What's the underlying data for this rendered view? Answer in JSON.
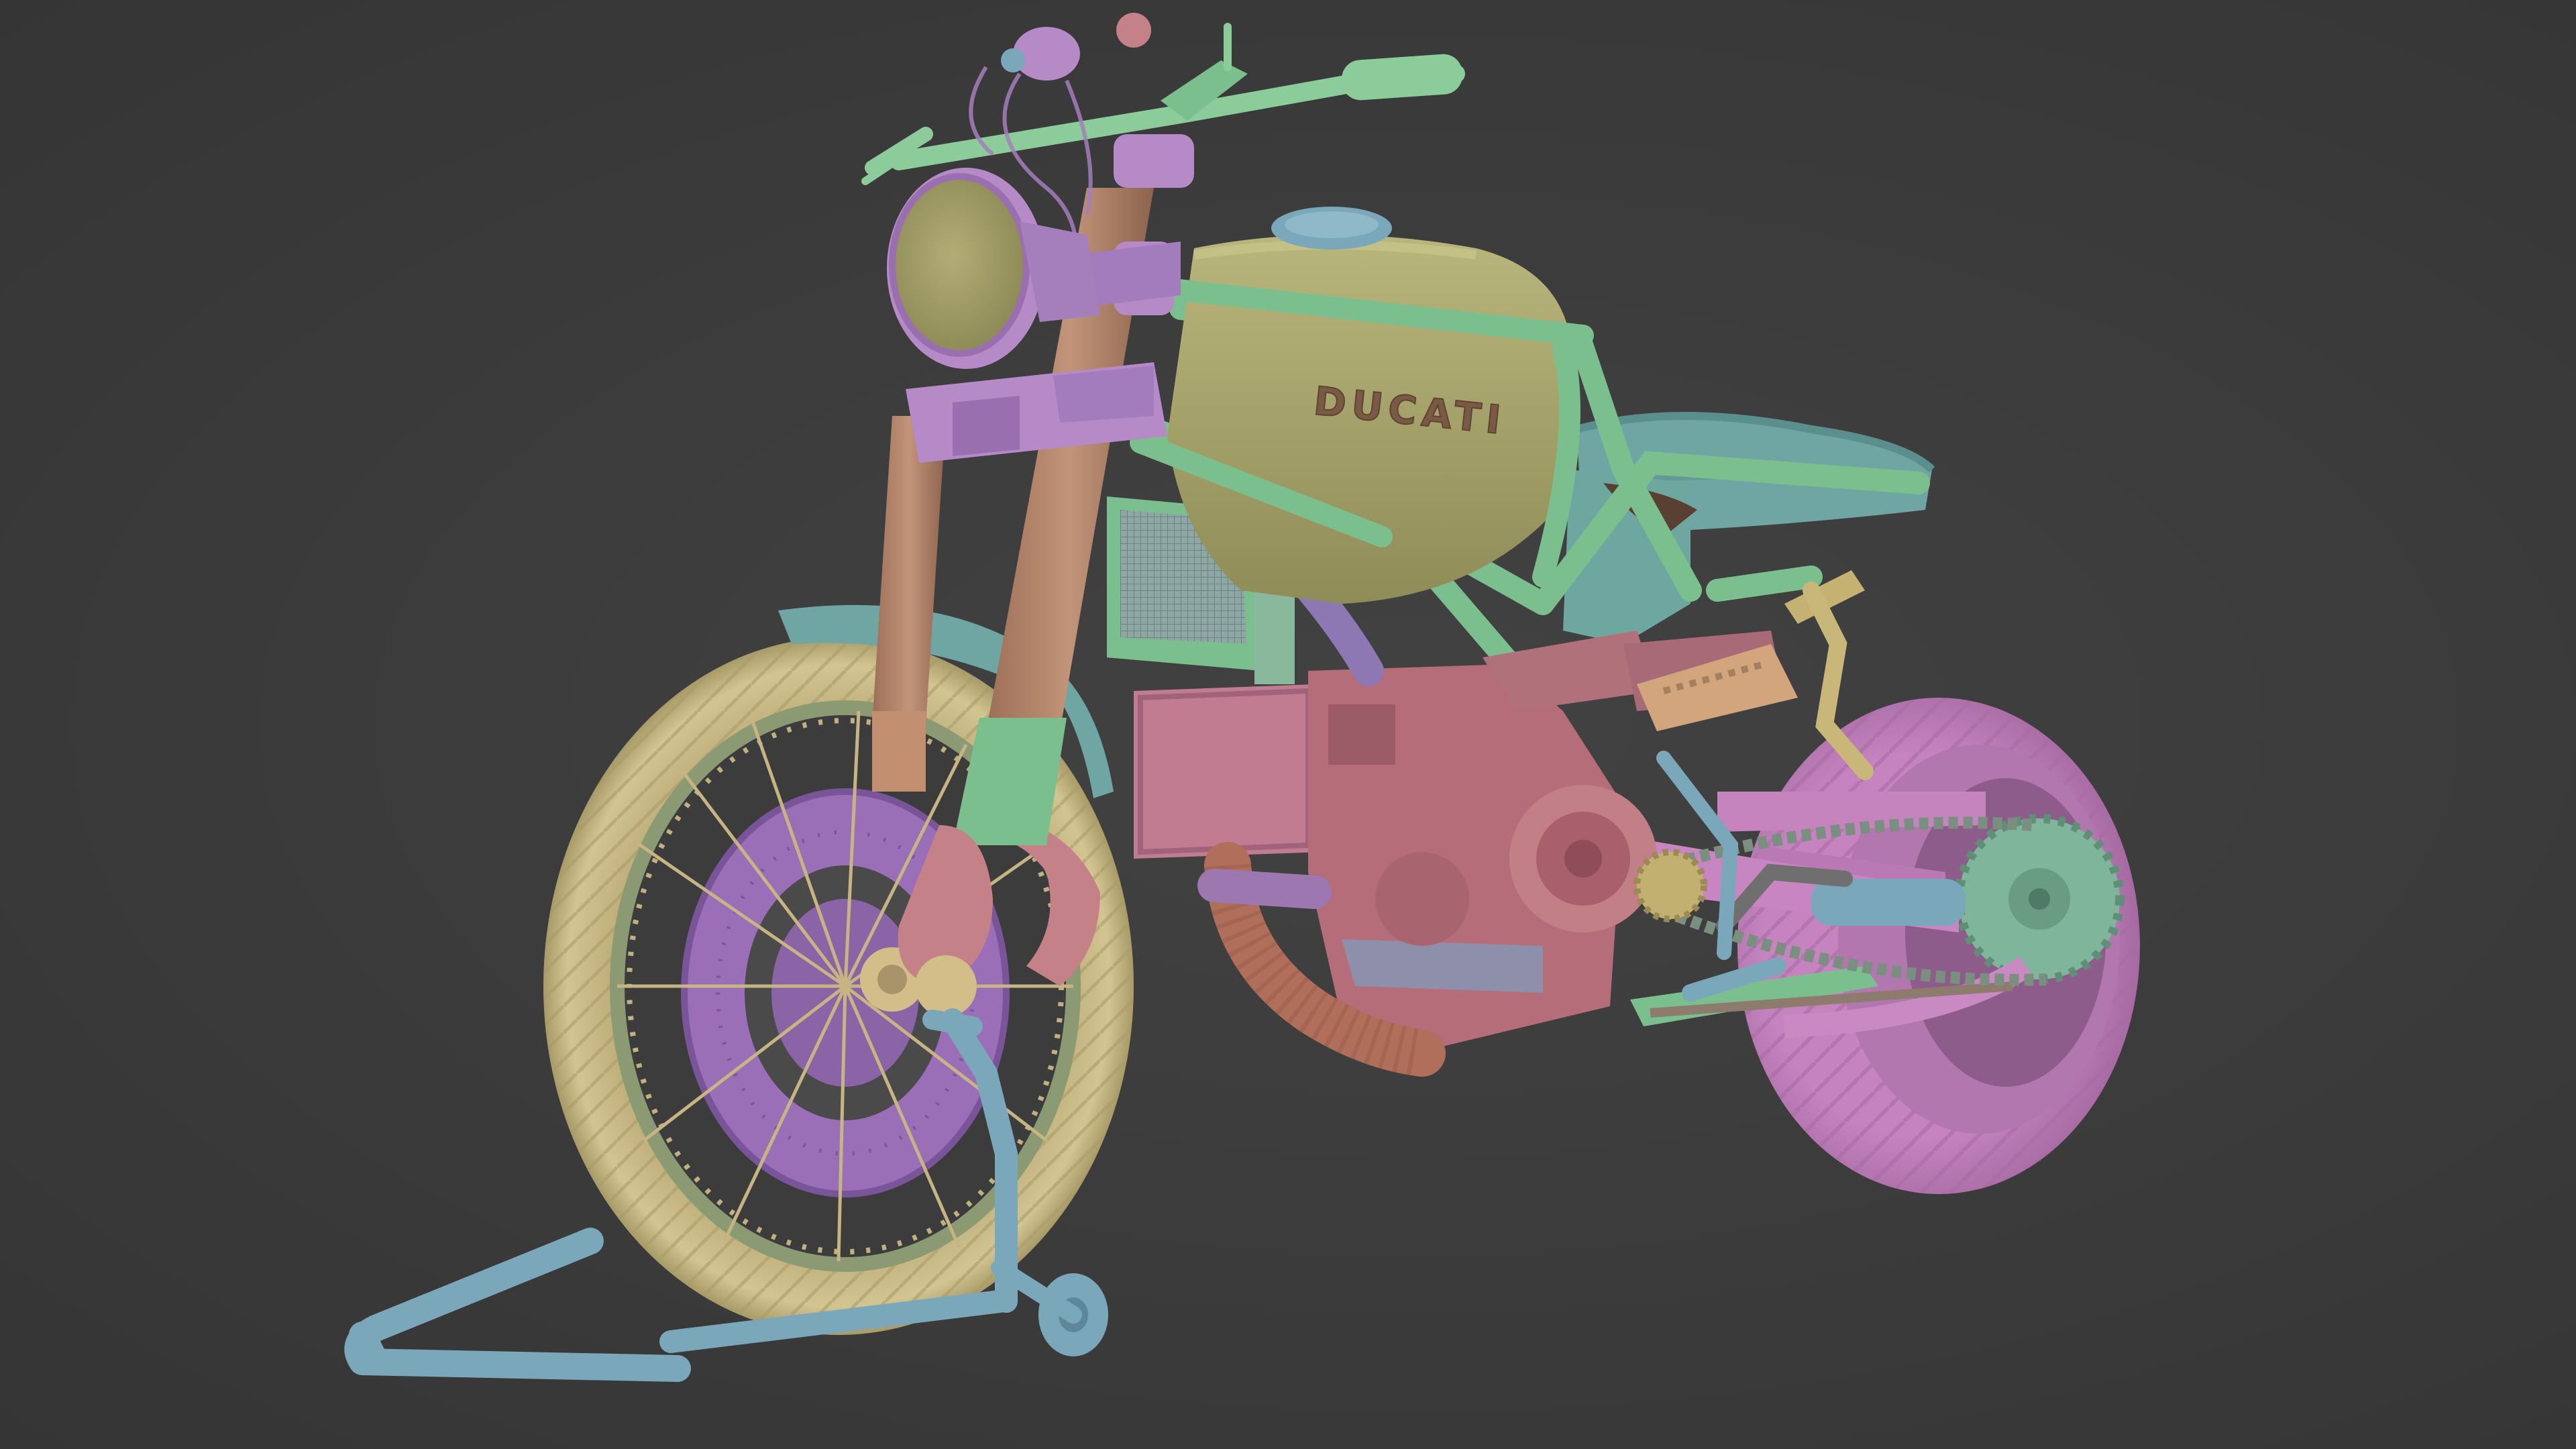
{
  "scene": {
    "brand_text": "DUCATI",
    "background_color": "#3a3a3a",
    "palette": {
      "front_tire": "#c9bb86",
      "rear_tire": "#c98ac4",
      "tank": "#a8a56d",
      "frame": "#7cbf8e",
      "seat": "#6fa5a3",
      "fork": "#b4866b",
      "engine": "#b86f7a",
      "brake_disc": "#9a6fb8",
      "stand": "#7ba7ba",
      "headlight": "#b58ac6",
      "handlebar": "#8ccc9a"
    }
  }
}
